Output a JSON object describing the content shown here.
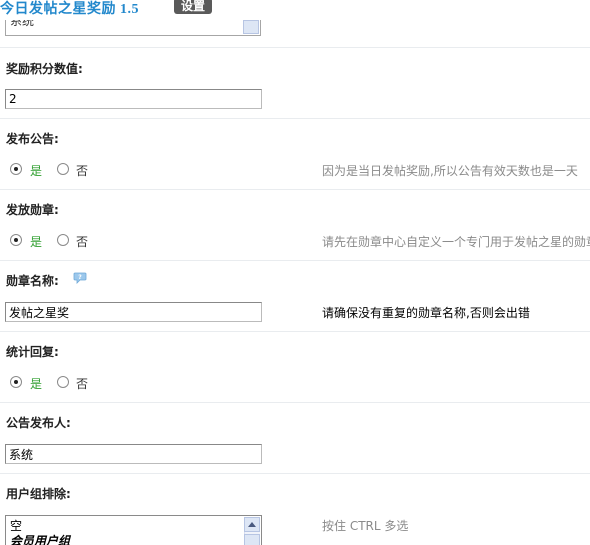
{
  "header": {
    "plugin_title": "今日发帖之星奖励  1.5",
    "settings_tag": "设置"
  },
  "top_select": {
    "value": "系统"
  },
  "fields": {
    "reward_points": {
      "label": "奖励积分数值:",
      "value": "2"
    },
    "publish_notice": {
      "label": "发布公告:",
      "yes_label": "是",
      "no_label": "否",
      "selected": "是",
      "hint": "因为是当日发帖奖励,所以公告有效天数也是一天"
    },
    "award_medal": {
      "label": "发放勋章:",
      "yes_label": "是",
      "no_label": "否",
      "selected": "是",
      "hint": "请先在勋章中心自定义一个专门用于发帖之星的勋章"
    },
    "medal_name": {
      "label": "勋章名称:",
      "value": "发帖之星奖",
      "hint": "请确保没有重复的勋章名称,否则会出错"
    },
    "count_replies": {
      "label": "统计回复:",
      "yes_label": "是",
      "no_label": "否",
      "selected": "是"
    },
    "notice_publisher": {
      "label": "公告发布人:",
      "value": "系统"
    },
    "exclude_groups": {
      "label": "用户组排除:",
      "options": [
        "空",
        "会员用户组"
      ],
      "hint": "按住 CTRL 多选"
    }
  },
  "colors": {
    "title_blue": "#2288cc",
    "tag_gray": "#5a5a5a",
    "yes_green": "#2e9e2e",
    "hint_gray": "#8a8a8a"
  },
  "icons": {
    "help": "speech-bubble-question-icon",
    "scroll_up": "triangle-up-icon"
  }
}
